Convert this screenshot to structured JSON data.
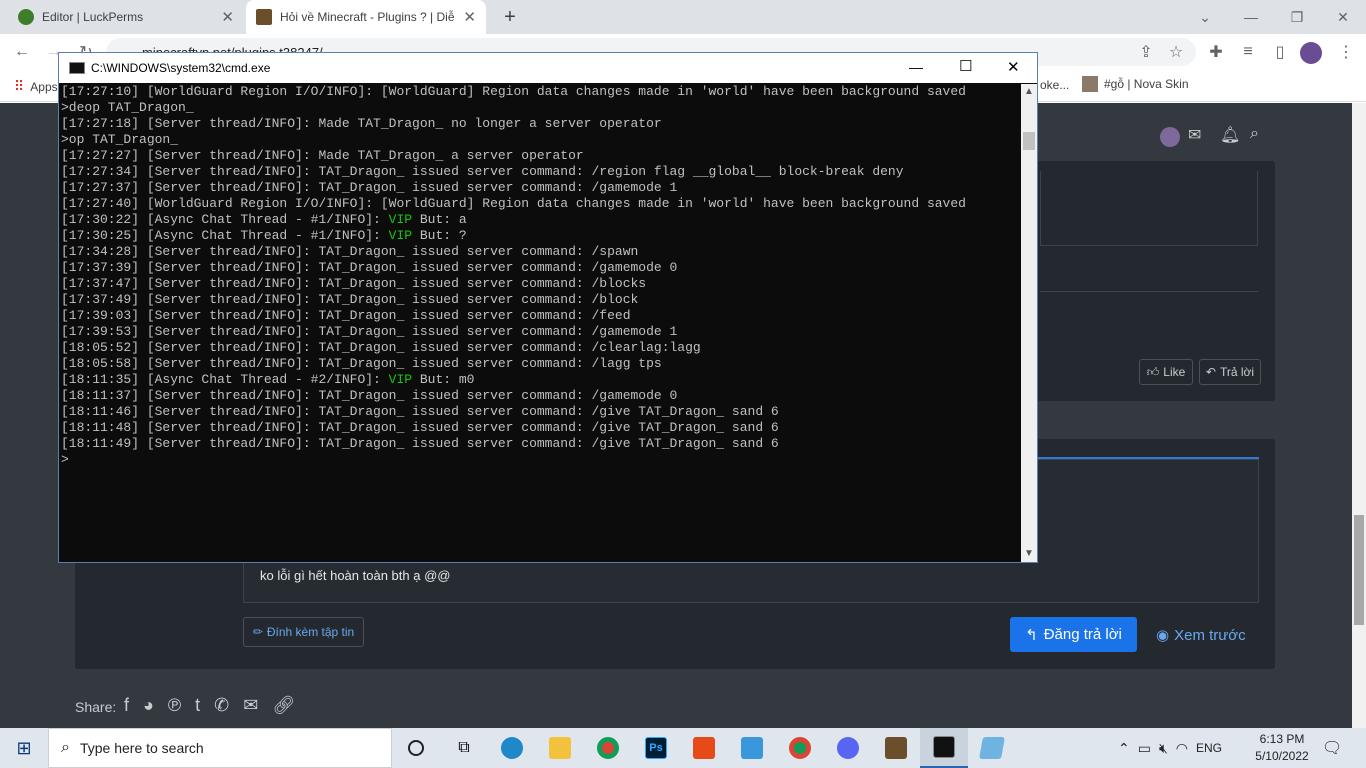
{
  "browser": {
    "tabs": [
      {
        "title": "Editor | LuckPerms",
        "active": false
      },
      {
        "title": "Hỏi về Minecraft - Plugins ? | Diễ",
        "active": true
      }
    ],
    "new_tab_label": "+",
    "url": "minecraftvn.net/plugins.t38247/",
    "bookmarks": [
      {
        "label": "Apps"
      },
      {
        "label": "oke..."
      },
      {
        "label": "#gỗ | Nova Skin"
      }
    ]
  },
  "forum": {
    "like_label": "Like",
    "reply_label": "Trả lời",
    "editor_text": "ko lỗi gì hết hoàn toàn bth ạ @@",
    "attach_label": "Đính kèm tập tin",
    "post_reply_label": "Đăng trả lời",
    "preview_label": "Xem trước",
    "share_label": "Share:"
  },
  "cmd": {
    "title": "C:\\WINDOWS\\system32\\cmd.exe",
    "lines": [
      {
        "text": "[17:27:10] [WorldGuard Region I/O/INFO]: [WorldGuard] Region data changes made in 'world' have been background saved"
      },
      {
        "text": ">deop TAT_Dragon_"
      },
      {
        "text": "[17:27:18] [Server thread/INFO]: Made TAT_Dragon_ no longer a server operator"
      },
      {
        "text": ">op TAT_Dragon_"
      },
      {
        "text": "[17:27:27] [Server thread/INFO]: Made TAT_Dragon_ a server operator"
      },
      {
        "text": "[17:27:34] [Server thread/INFO]: TAT_Dragon_ issued server command: /region flag __global__ block-break deny"
      },
      {
        "text": "[17:27:37] [Server thread/INFO]: TAT_Dragon_ issued server command: /gamemode 1"
      },
      {
        "text": "[17:27:40] [WorldGuard Region I/O/INFO]: [WorldGuard] Region data changes made in 'world' have been background saved"
      },
      {
        "text": "[17:30:22] [Async Chat Thread - #1/INFO]: ",
        "green": "VIP",
        "rest": " But: a"
      },
      {
        "text": "[17:30:25] [Async Chat Thread - #1/INFO]: ",
        "green": "VIP",
        "rest": " But: ?"
      },
      {
        "text": "[17:34:28] [Server thread/INFO]: TAT_Dragon_ issued server command: /spawn"
      },
      {
        "text": "[17:37:39] [Server thread/INFO]: TAT_Dragon_ issued server command: /gamemode 0"
      },
      {
        "text": "[17:37:47] [Server thread/INFO]: TAT_Dragon_ issued server command: /blocks"
      },
      {
        "text": "[17:37:49] [Server thread/INFO]: TAT_Dragon_ issued server command: /block"
      },
      {
        "text": "[17:39:03] [Server thread/INFO]: TAT_Dragon_ issued server command: /feed"
      },
      {
        "text": "[17:39:53] [Server thread/INFO]: TAT_Dragon_ issued server command: /gamemode 1"
      },
      {
        "text": "[18:05:52] [Server thread/INFO]: TAT_Dragon_ issued server command: /clearlag:lagg"
      },
      {
        "text": "[18:05:58] [Server thread/INFO]: TAT_Dragon_ issued server command: /lagg tps"
      },
      {
        "text": "[18:11:35] [Async Chat Thread - #2/INFO]: ",
        "green": "VIP",
        "rest": " But: m0"
      },
      {
        "text": "[18:11:37] [Server thread/INFO]: TAT_Dragon_ issued server command: /gamemode 0"
      },
      {
        "text": "[18:11:46] [Server thread/INFO]: TAT_Dragon_ issued server command: /give TAT_Dragon_ sand 6"
      },
      {
        "text": "[18:11:48] [Server thread/INFO]: TAT_Dragon_ issued server command: /give TAT_Dragon_ sand 6"
      },
      {
        "text": "[18:11:49] [Server thread/INFO]: TAT_Dragon_ issued server command: /give TAT_Dragon_ sand 6"
      },
      {
        "text": ">"
      }
    ]
  },
  "taskbar": {
    "search_placeholder": "Type here to search",
    "language": "ENG",
    "time": "6:13 PM",
    "date": "5/10/2022"
  },
  "colors": {
    "accent": "#1a73e8",
    "page_bg": "#33393f",
    "console_green": "#16c60c"
  }
}
